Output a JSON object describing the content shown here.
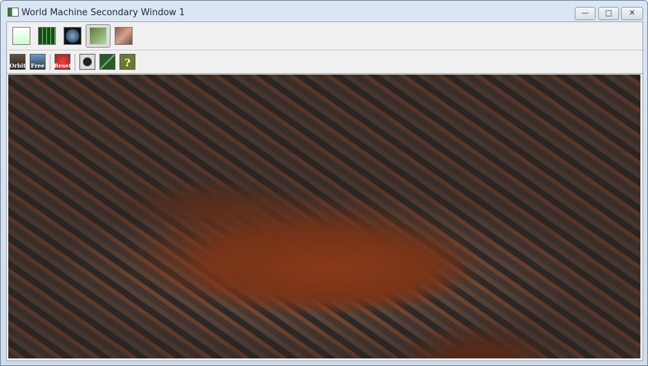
{
  "window": {
    "title": "World Machine Secondary Window 1",
    "minimize": "—",
    "maximize": "□",
    "close": "✕"
  },
  "toolbar1": [
    {
      "name": "device-view"
    },
    {
      "name": "layout-view"
    },
    {
      "name": "world-view"
    },
    {
      "name": "3d-preview",
      "selected": true
    },
    {
      "name": "texture-view"
    }
  ],
  "toolbar2": {
    "orbit": "Orbit",
    "free": "Free",
    "reset": "Reset"
  }
}
